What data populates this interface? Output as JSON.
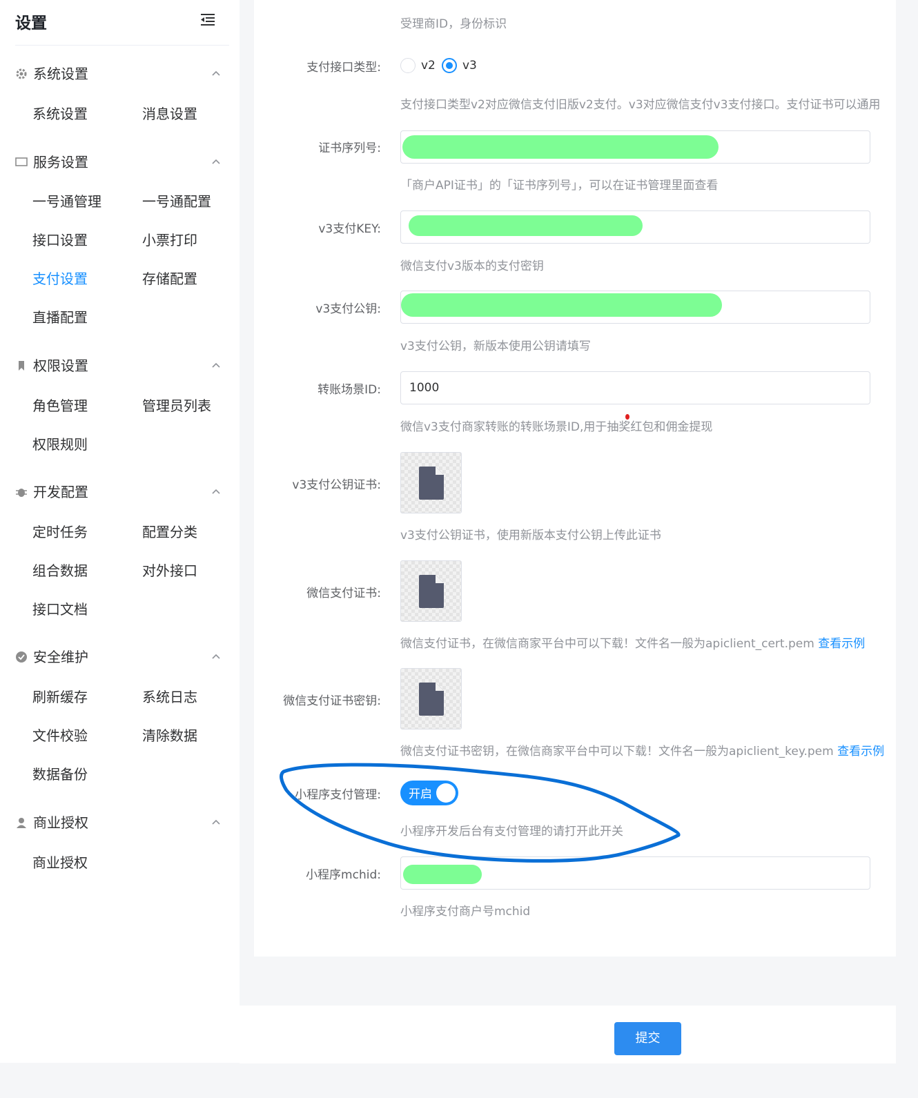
{
  "sidebar": {
    "title": "设置",
    "groups": [
      {
        "label": "系统设置",
        "icon": "gear-icon",
        "items": [
          "系统设置",
          "消息设置"
        ]
      },
      {
        "label": "服务设置",
        "icon": "monitor-icon",
        "items": [
          "一号通管理",
          "一号通配置",
          "接口设置",
          "小票打印",
          "支付设置",
          "存储配置",
          "直播配置"
        ]
      },
      {
        "label": "权限设置",
        "icon": "bookmark-icon",
        "items": [
          "角色管理",
          "管理员列表",
          "权限规则"
        ]
      },
      {
        "label": "开发配置",
        "icon": "bug-icon",
        "items": [
          "定时任务",
          "配置分类",
          "组合数据",
          "对外接口",
          "接口文档"
        ]
      },
      {
        "label": "安全维护",
        "icon": "check-circle-icon",
        "items": [
          "刷新缓存",
          "系统日志",
          "文件校验",
          "清除数据",
          "数据备份"
        ]
      },
      {
        "label": "商业授权",
        "icon": "user-badge-icon",
        "items": [
          "商业授权"
        ]
      }
    ],
    "active_item": "支付设置"
  },
  "form": {
    "top_hint": "受理商ID，身份标识",
    "api_type": {
      "label": "支付接口类型:",
      "options": [
        "v2",
        "v3"
      ],
      "selected": "v3",
      "hint": "支付接口类型v2对应微信支付旧版v2支付。v3对应微信支付v3支付接口。支付证书可以通用"
    },
    "cert_serial": {
      "label": "证书序列号:",
      "hint": "「商户API证书」的「证书序列号」，可以在证书管理里面查看"
    },
    "v3_key": {
      "label": "v3支付KEY:",
      "hint": "微信支付v3版本的支付密钥"
    },
    "v3_pubkey": {
      "label": "v3支付公钥:",
      "hint": "v3支付公钥，新版本使用公钥请填写"
    },
    "transfer_scene": {
      "label": "转账场景ID:",
      "value": "1000",
      "hint": "微信v3支付商家转账的转账场景ID,用于抽奖红包和佣金提现"
    },
    "v3_pubkey_cert": {
      "label": "v3支付公钥证书:",
      "hint": "v3支付公钥证书，使用新版本支付公钥上传此证书"
    },
    "wx_cert": {
      "label": "微信支付证书:",
      "hint": "微信支付证书，在微信商家平台中可以下载！文件名一般为apiclient_cert.pem",
      "link": "查看示例"
    },
    "wx_cert_key": {
      "label": "微信支付证书密钥:",
      "hint": "微信支付证书密钥，在微信商家平台中可以下载！文件名一般为apiclient_key.pem",
      "link": "查看示例"
    },
    "mini_pay": {
      "label": "小程序支付管理:",
      "switch_text": "开启",
      "hint": "小程序开发后台有支付管理的请打开此开关"
    },
    "mini_mchid": {
      "label": "小程序mchid:",
      "hint": "小程序支付商户号mchid"
    }
  },
  "submit_label": "提交",
  "colors": {
    "accent": "#1890ff",
    "button": "#2d8cf0",
    "redaction": "#7dfd94",
    "annotation": "#0a6fd6"
  }
}
